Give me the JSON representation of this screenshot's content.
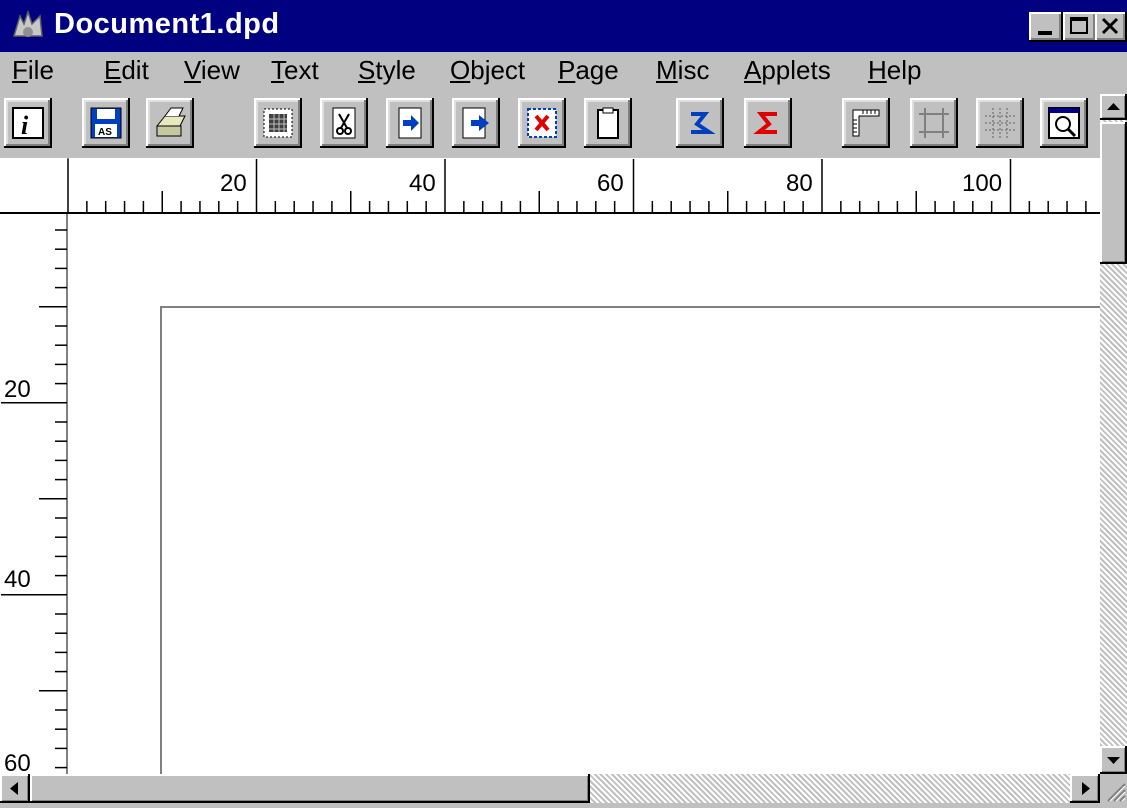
{
  "window": {
    "title": "Document1.dpd",
    "controls": [
      "minimize",
      "maximize",
      "close"
    ]
  },
  "menu": [
    "File",
    "Edit",
    "View",
    "Text",
    "Style",
    "Object",
    "Page",
    "Misc",
    "Applets",
    "Help"
  ],
  "toolbar": {
    "buttons": [
      "info-icon",
      "save-icon",
      "print-icon",
      "grid-select-icon",
      "cut-icon",
      "copy-icon",
      "paste-icon",
      "delete-icon",
      "clipboard-icon",
      "undo-icon",
      "redo-icon",
      "ruler-icon",
      "crop-icon",
      "snap-grid-icon",
      "zoom-icon"
    ]
  },
  "ruler": {
    "horizontal_labels": [
      "20",
      "40",
      "60",
      "80",
      "100"
    ],
    "vertical_labels": [
      "20",
      "40",
      "60"
    ]
  },
  "colors": {
    "titlebar": "#000080",
    "face": "#c0c0c0",
    "accent_blue": "#0040c0",
    "accent_red": "#e00000"
  }
}
